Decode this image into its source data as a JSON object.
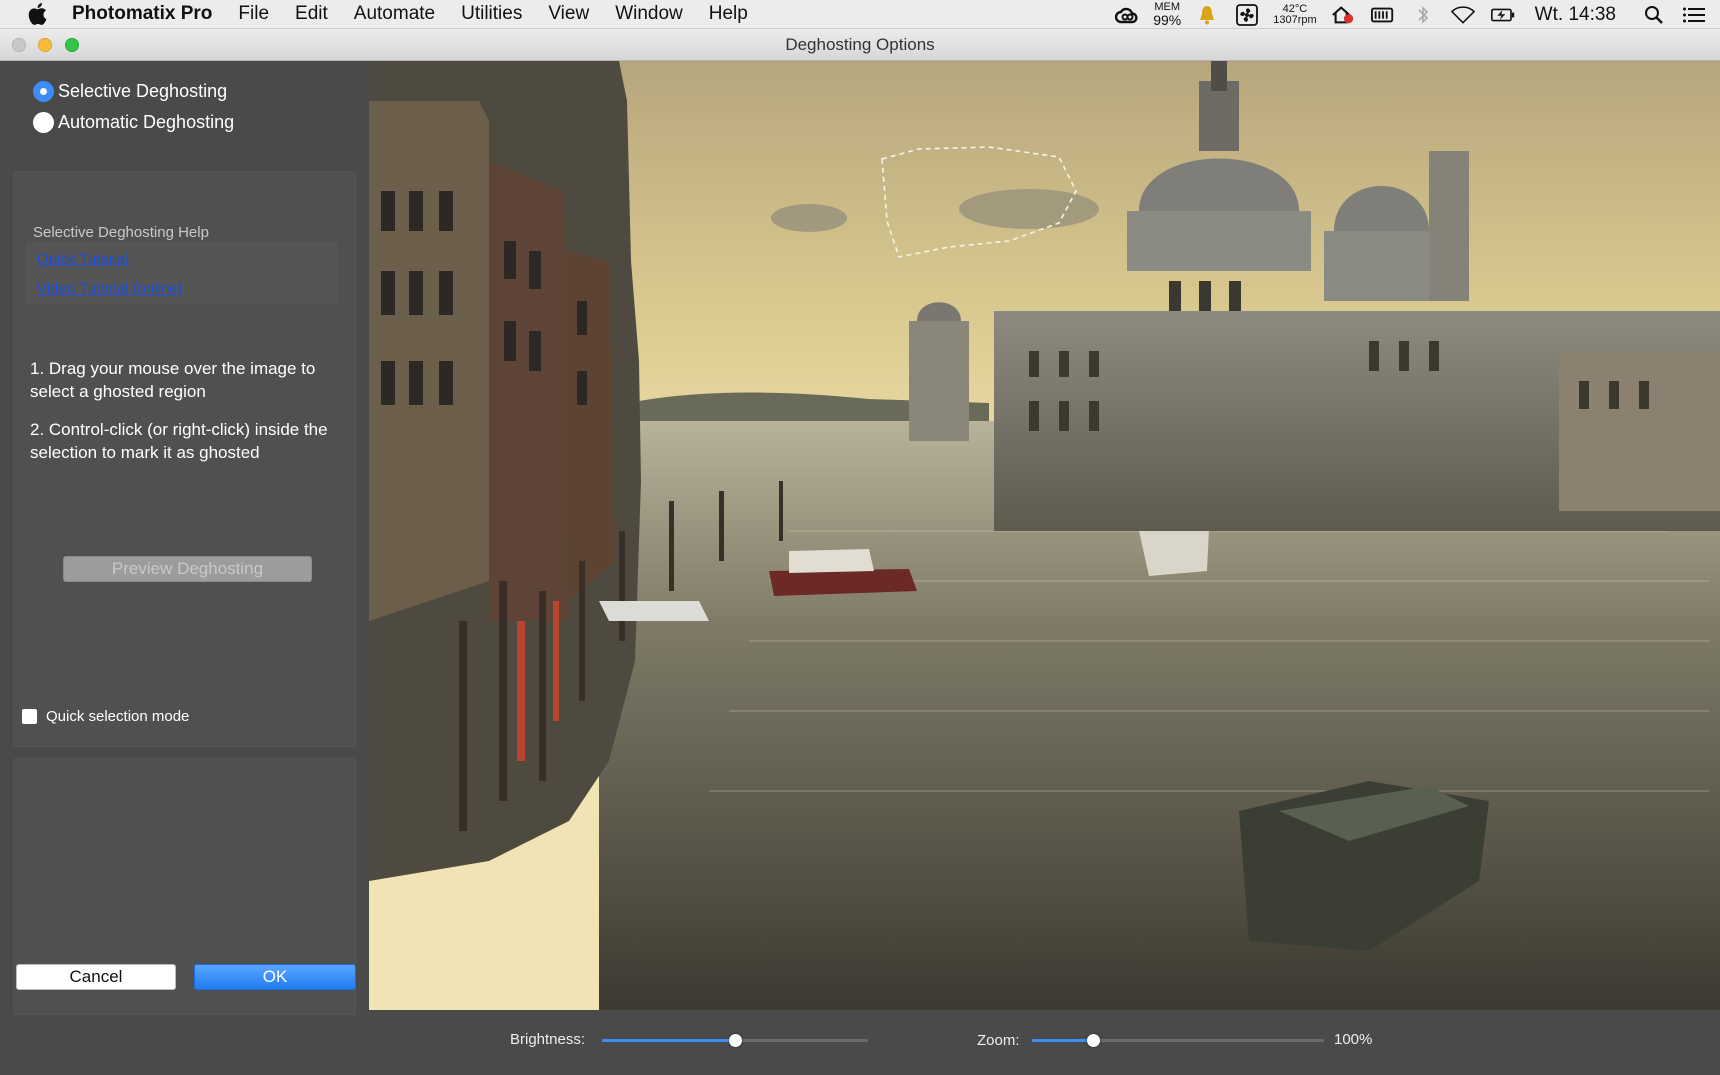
{
  "menubar": {
    "app_name": "Photomatix Pro",
    "menus": [
      "File",
      "Edit",
      "Automate",
      "Utilities",
      "View",
      "Window",
      "Help"
    ],
    "mem_label": "MEM",
    "mem_value": "99%",
    "temp": "42°C",
    "rpm": "1307rpm",
    "clock": "Wt. 14:38",
    "status_icons": [
      "creative-cloud-icon",
      "mem-monitor",
      "notification-bell-icon",
      "fan-icon",
      "temperature-monitor",
      "home-alert-icon",
      "battery-meter-icon",
      "bluetooth-icon",
      "wifi-icon",
      "battery-charging-icon",
      "spotlight-search-icon",
      "notification-center-icon"
    ]
  },
  "window": {
    "title": "Deghosting Options"
  },
  "left_panel": {
    "mode_options": [
      {
        "label": "Selective Deghosting",
        "selected": true
      },
      {
        "label": "Automatic Deghosting",
        "selected": false
      }
    ],
    "help": {
      "title": "Selective Deghosting Help",
      "links": [
        "Quick Tutorial",
        "Video Tutorial (online)"
      ]
    },
    "instructions": [
      "1. Drag your mouse over the image to select a ghosted region",
      "2. Control-click (or right-click) inside the selection to mark it as ghosted"
    ],
    "preview_button": "Preview Deghosting",
    "quick_selection": {
      "label": "Quick selection mode",
      "checked": false
    },
    "cancel_button": "Cancel",
    "ok_button": "OK"
  },
  "bottom_bar": {
    "brightness": {
      "label": "Brightness:",
      "value": 0.5
    },
    "zoom": {
      "label": "Zoom:",
      "value_text": "100%",
      "value": 0.21
    }
  },
  "colors": {
    "accent": "#3b8cf5",
    "panel_bg": "#4a4a4a"
  }
}
